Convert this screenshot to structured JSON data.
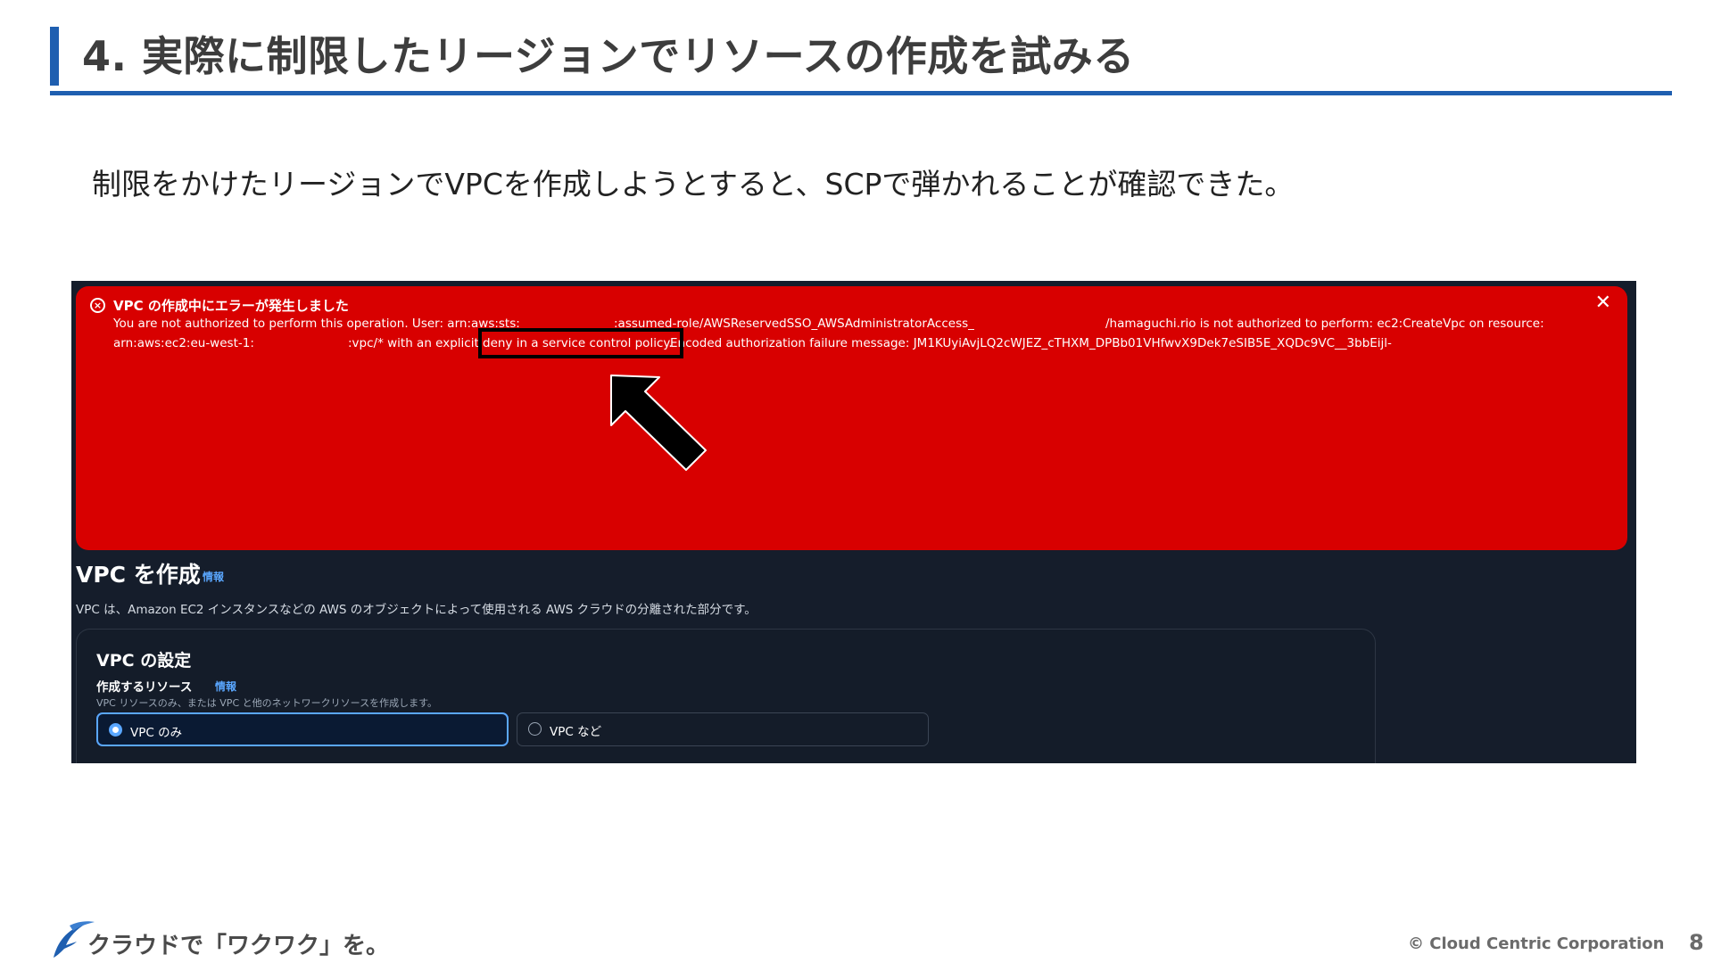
{
  "slide": {
    "title": "4. 実際に制限したリージョンでリソースの作成を試みる",
    "subtitle": "制限をかけたリージョンでVPCを作成しようとすると、SCPで弾かれることが確認できた。",
    "accent_color": "#1f5fb0"
  },
  "error_flash": {
    "icon": "error-circle-icon",
    "title": "VPC の作成中にエラーが発生しました",
    "close_icon": "close-icon",
    "line1_a": "You are not authorized to perform this operation. User: arn:aws:sts:",
    "line1_b": ":assumed-role/AWSReservedSSO_AWSAdministratorAccess_",
    "line1_c": "/hamaguchi.rio is not authorized to perform: ec2:CreateVpc on resource:",
    "line2_a": "arn:aws:ec2:eu-west-1:",
    "line2_b": ":vpc/* with an explicit",
    "line2_highlight": "deny in a service control policy.",
    "line2_c": "Encoded authorization failure message: JM1KUyiAvjLQ2cWJEZ_cTHXM_DPBb01VHfwvX9Dek7eSIB5E_XQDc9VC__3bbEijl-",
    "background_color": "#d80000"
  },
  "page": {
    "heading": "VPC を作成",
    "info_label": "情報",
    "description": "VPC は、Amazon EC2 インスタンスなどの AWS のオブジェクトによって使用される AWS クラウドの分離された部分です。"
  },
  "vpc_settings": {
    "title": "VPC の設定",
    "resource_label": "作成するリソース",
    "info_label": "情報",
    "resource_hint": "VPC リソースのみ、または VPC と他のネットワークリソースを作成します。",
    "options": [
      {
        "label": "VPC のみ",
        "selected": true
      },
      {
        "label": "VPC など",
        "selected": false
      }
    ]
  },
  "footer": {
    "tagline": "クラウドで「ワクワク」を。",
    "copyright": "© Cloud Centric Corporation",
    "page_number": "8"
  }
}
